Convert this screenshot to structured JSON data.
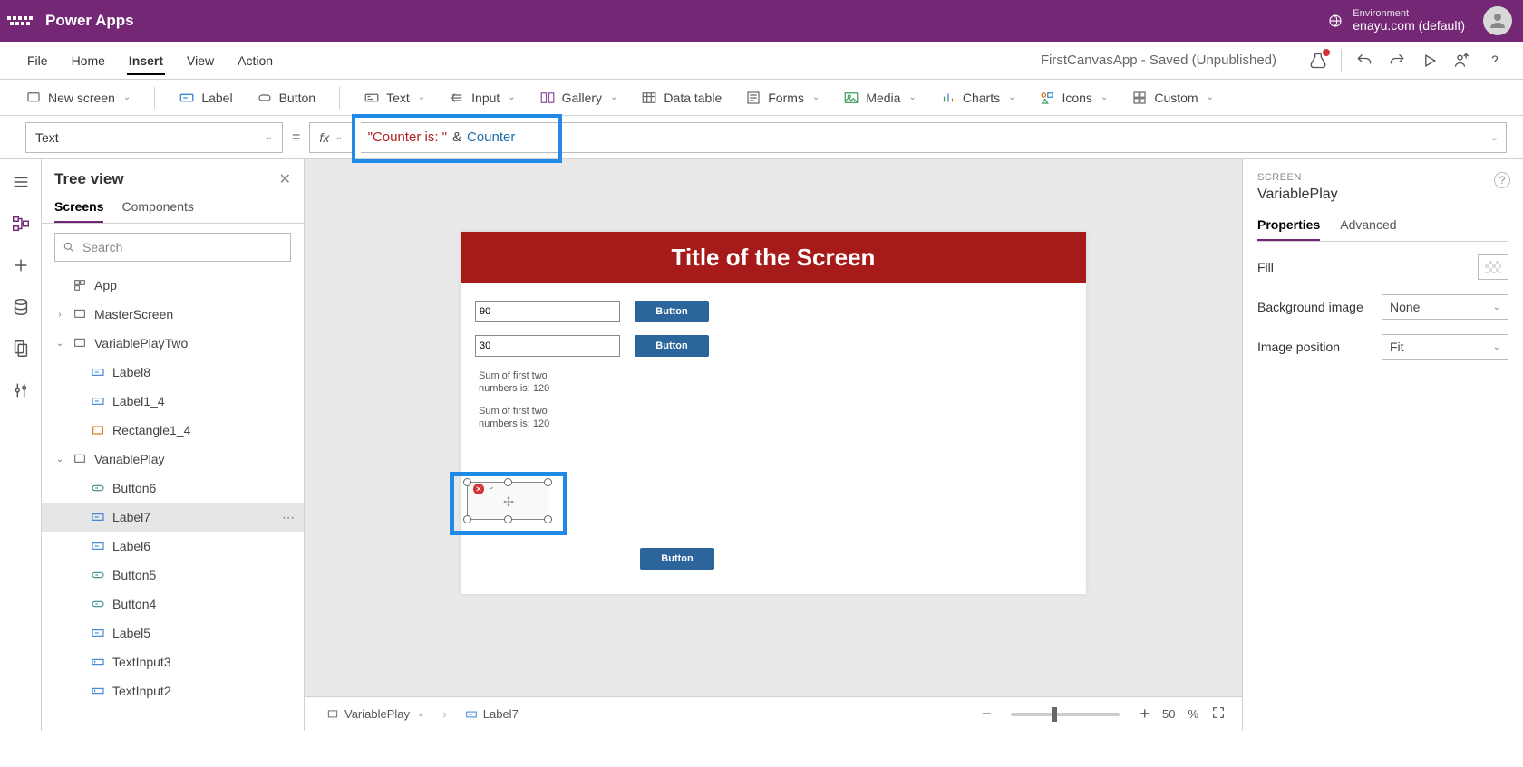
{
  "topbar": {
    "brand": "Power Apps",
    "env_label": "Environment",
    "env_value": "enayu.com (default)"
  },
  "menubar": {
    "items": [
      "File",
      "Home",
      "Insert",
      "View",
      "Action"
    ],
    "active": "Insert",
    "app_status": "FirstCanvasApp - Saved (Unpublished)"
  },
  "ribbon": {
    "new_screen": "New screen",
    "label": "Label",
    "button": "Button",
    "text": "Text",
    "input": "Input",
    "gallery": "Gallery",
    "data_table": "Data table",
    "forms": "Forms",
    "media": "Media",
    "charts": "Charts",
    "icons": "Icons",
    "custom": "Custom"
  },
  "formula": {
    "property": "Text",
    "value_str": "\"Counter is: \"",
    "value_op": "&",
    "value_var": "Counter"
  },
  "tree": {
    "title": "Tree view",
    "tabs": [
      "Screens",
      "Components"
    ],
    "active_tab": "Screens",
    "search_placeholder": "Search",
    "nodes": [
      {
        "label": "App",
        "icon": "app",
        "indent": 0,
        "twisty": ""
      },
      {
        "label": "MasterScreen",
        "icon": "screen",
        "indent": 0,
        "twisty": "›"
      },
      {
        "label": "VariablePlayTwo",
        "icon": "screen",
        "indent": 0,
        "twisty": "⌄"
      },
      {
        "label": "Label8",
        "icon": "label",
        "indent": 1,
        "twisty": ""
      },
      {
        "label": "Label1_4",
        "icon": "label",
        "indent": 1,
        "twisty": ""
      },
      {
        "label": "Rectangle1_4",
        "icon": "rect",
        "indent": 1,
        "twisty": ""
      },
      {
        "label": "VariablePlay",
        "icon": "screen",
        "indent": 0,
        "twisty": "⌄"
      },
      {
        "label": "Button6",
        "icon": "button",
        "indent": 1,
        "twisty": ""
      },
      {
        "label": "Label7",
        "icon": "label",
        "indent": 1,
        "twisty": "",
        "selected": true
      },
      {
        "label": "Label6",
        "icon": "label",
        "indent": 1,
        "twisty": ""
      },
      {
        "label": "Button5",
        "icon": "button",
        "indent": 1,
        "twisty": ""
      },
      {
        "label": "Button4",
        "icon": "button",
        "indent": 1,
        "twisty": ""
      },
      {
        "label": "Label5",
        "icon": "label",
        "indent": 1,
        "twisty": ""
      },
      {
        "label": "TextInput3",
        "icon": "input",
        "indent": 1,
        "twisty": ""
      },
      {
        "label": "TextInput2",
        "icon": "input",
        "indent": 1,
        "twisty": ""
      }
    ]
  },
  "canvas": {
    "screen_title": "Title of the Screen",
    "input1": "90",
    "input2": "30",
    "btn": "Button",
    "sum1": "Sum of first two numbers is: 120",
    "sum2": "Sum of first two numbers is: 120"
  },
  "footer": {
    "crumb_screen": "VariablePlay",
    "crumb_elem": "Label7",
    "zoom": "50",
    "zoom_suffix": "%"
  },
  "props": {
    "category": "SCREEN",
    "name": "VariablePlay",
    "tabs": [
      "Properties",
      "Advanced"
    ],
    "active_tab": "Properties",
    "rows": [
      {
        "label": "Fill",
        "type": "swatch"
      },
      {
        "label": "Background image",
        "type": "select",
        "value": "None"
      },
      {
        "label": "Image position",
        "type": "select",
        "value": "Fit"
      }
    ]
  }
}
